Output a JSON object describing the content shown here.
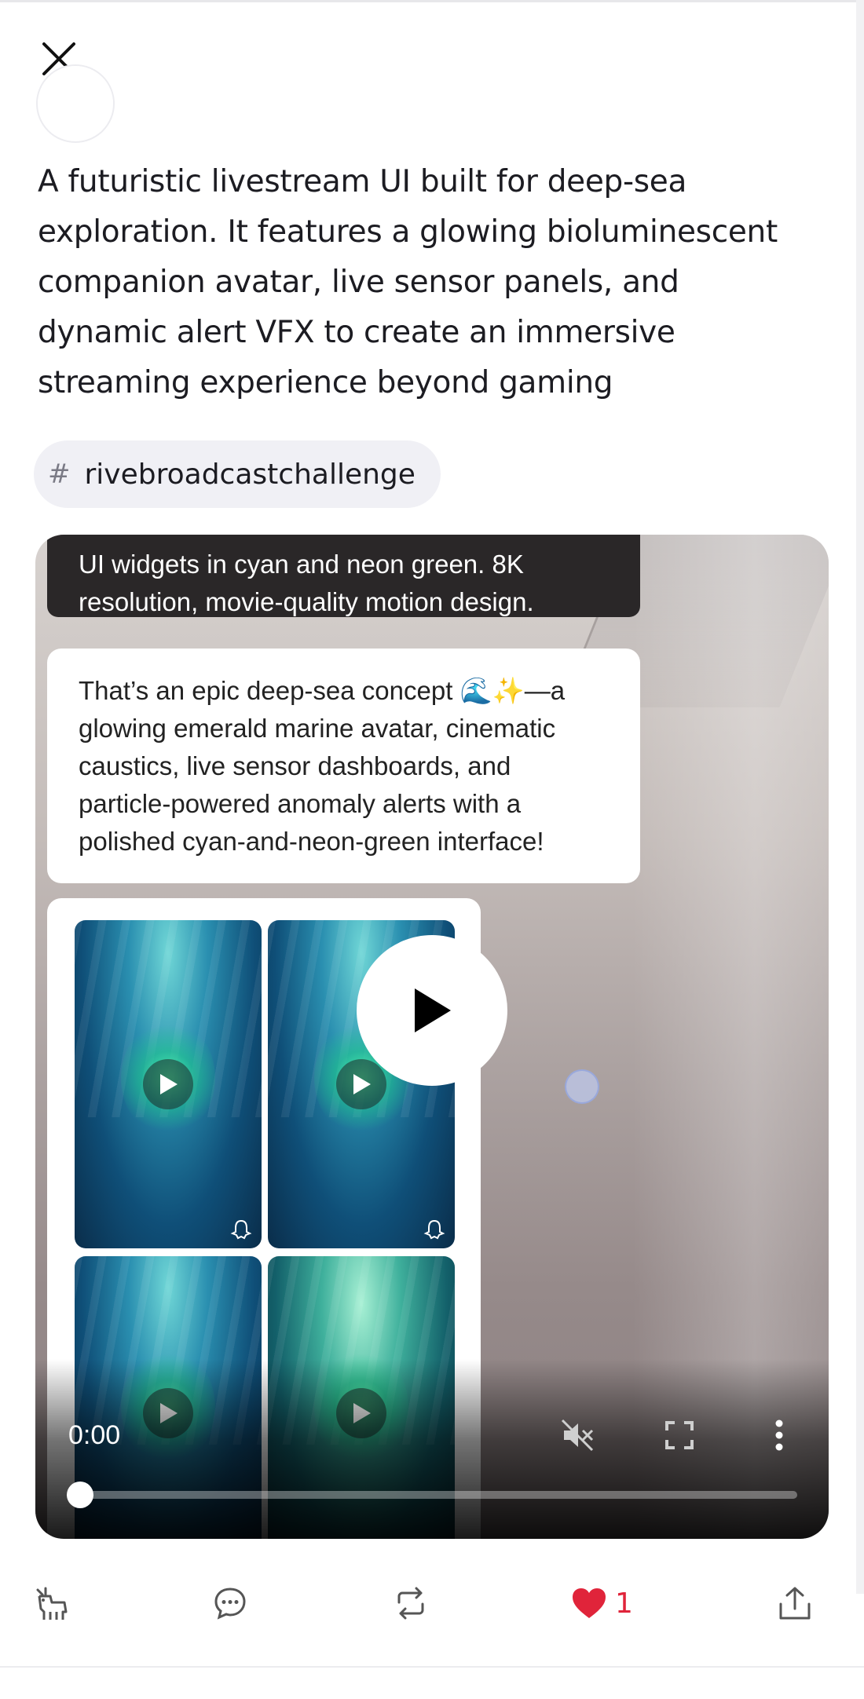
{
  "post": {
    "text": "A futuristic livestream UI built for deep-sea exploration. It features a glowing bioluminescent companion avatar, live sensor panels, and dynamic alert VFX to create an immersive streaming experience beyond gaming",
    "hashtag_symbol": "#",
    "hashtag": "rivebroadcastchallenge"
  },
  "video": {
    "bubble_prompt": "UI widgets in cyan and neon green. 8K resolution, movie-quality motion design.",
    "bubble_reply": "That’s an epic deep-sea concept 🌊✨—a glowing emerald marine avatar, cinematic caustics, live sensor dashboards, and particle-powered anomaly alerts with a polished cyan-and-neon-green interface!",
    "time": "0:00",
    "progress": 0
  },
  "actions": {
    "like_count": "1"
  },
  "icons": [
    "close-icon",
    "play-icon",
    "mute-icon",
    "fullscreen-icon",
    "more-icon",
    "goat-icon",
    "comment-icon",
    "repost-icon",
    "heart-icon",
    "share-icon",
    "ghost-icon"
  ],
  "colors": {
    "like": "#e0243a",
    "tag_bg": "#f0f0f5"
  }
}
